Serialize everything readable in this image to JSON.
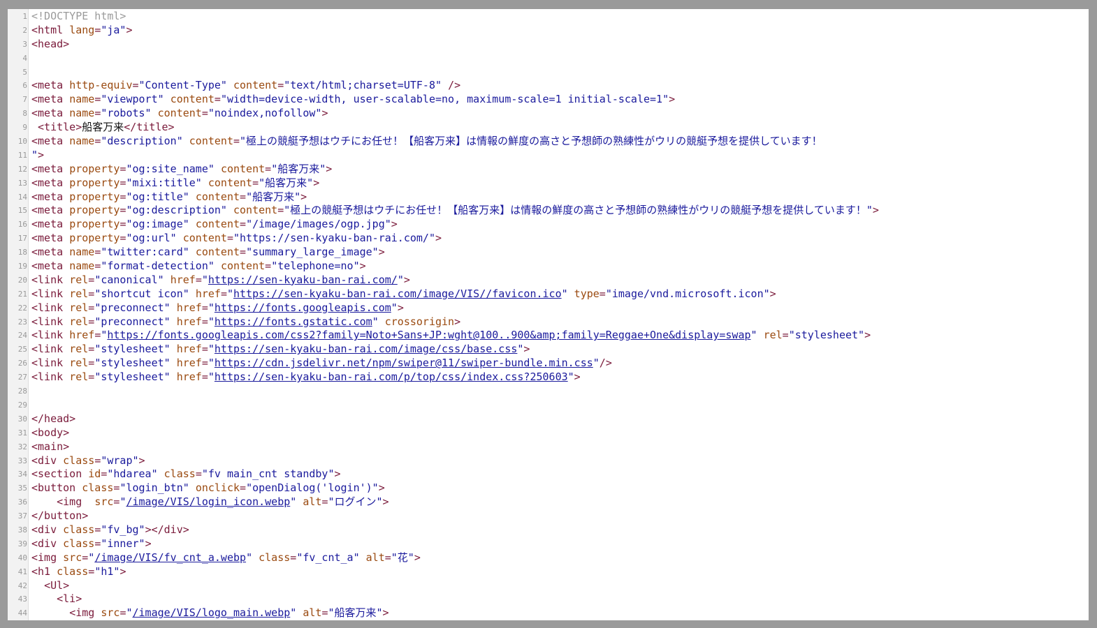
{
  "lines": [
    [
      [
        "doctype",
        "<!DOCTYPE html>"
      ]
    ],
    [
      [
        "tag",
        "<html "
      ],
      [
        "an",
        "lang"
      ],
      [
        "tag",
        "="
      ],
      [
        "av",
        "\"ja\""
      ],
      [
        "tag",
        ">"
      ]
    ],
    [
      [
        "tag",
        "<head>"
      ]
    ],
    [],
    [],
    [
      [
        "tag",
        "<meta "
      ],
      [
        "an",
        "http-equiv"
      ],
      [
        "tag",
        "="
      ],
      [
        "av",
        "\"Content-Type\""
      ],
      [
        "tx",
        " "
      ],
      [
        "an",
        "content"
      ],
      [
        "tag",
        "="
      ],
      [
        "av",
        "\"text/html;charset=UTF-8\""
      ],
      [
        "tx",
        " "
      ],
      [
        "tag",
        "/>"
      ]
    ],
    [
      [
        "tag",
        "<meta "
      ],
      [
        "an",
        "name"
      ],
      [
        "tag",
        "="
      ],
      [
        "av",
        "\"viewport\""
      ],
      [
        "tx",
        " "
      ],
      [
        "an",
        "content"
      ],
      [
        "tag",
        "="
      ],
      [
        "av",
        "\"width=device-width, user-scalable=no, maximum-scale=1 initial-scale=1\""
      ],
      [
        "tag",
        ">"
      ]
    ],
    [
      [
        "tag",
        "<meta "
      ],
      [
        "an",
        "name"
      ],
      [
        "tag",
        "="
      ],
      [
        "av",
        "\"robots\""
      ],
      [
        "tx",
        " "
      ],
      [
        "an",
        "content"
      ],
      [
        "tag",
        "="
      ],
      [
        "av",
        "\"noindex,nofollow\""
      ],
      [
        "tag",
        ">"
      ]
    ],
    [
      [
        "tx",
        " "
      ],
      [
        "tag",
        "<title>"
      ],
      [
        "tx",
        "船客万来"
      ],
      [
        "tag",
        "</title>"
      ]
    ],
    [
      [
        "tag",
        "<meta "
      ],
      [
        "an",
        "name"
      ],
      [
        "tag",
        "="
      ],
      [
        "av",
        "\"description\""
      ],
      [
        "tx",
        " "
      ],
      [
        "an",
        "content"
      ],
      [
        "tag",
        "="
      ],
      [
        "av",
        "\"極上の競艇予想はウチにお任せ！【船客万来】は情報の鮮度の高さと予想師の熟練性がウリの競艇予想を提供しています！"
      ]
    ],
    [
      [
        "av",
        "\""
      ],
      [
        "tag",
        ">"
      ]
    ],
    [
      [
        "tag",
        "<meta "
      ],
      [
        "an",
        "property"
      ],
      [
        "tag",
        "="
      ],
      [
        "av",
        "\"og:site_name\""
      ],
      [
        "tx",
        " "
      ],
      [
        "an",
        "content"
      ],
      [
        "tag",
        "="
      ],
      [
        "av",
        "\"船客万来\""
      ],
      [
        "tag",
        ">"
      ]
    ],
    [
      [
        "tag",
        "<meta "
      ],
      [
        "an",
        "property"
      ],
      [
        "tag",
        "="
      ],
      [
        "av",
        "\"mixi:title\""
      ],
      [
        "tx",
        " "
      ],
      [
        "an",
        "content"
      ],
      [
        "tag",
        "="
      ],
      [
        "av",
        "\"船客万来\""
      ],
      [
        "tag",
        ">"
      ]
    ],
    [
      [
        "tag",
        "<meta "
      ],
      [
        "an",
        "property"
      ],
      [
        "tag",
        "="
      ],
      [
        "av",
        "\"og:title\""
      ],
      [
        "tx",
        " "
      ],
      [
        "an",
        "content"
      ],
      [
        "tag",
        "="
      ],
      [
        "av",
        "\"船客万来\""
      ],
      [
        "tag",
        ">"
      ]
    ],
    [
      [
        "tag",
        "<meta "
      ],
      [
        "an",
        "property"
      ],
      [
        "tag",
        "="
      ],
      [
        "av",
        "\"og:description\""
      ],
      [
        "tx",
        " "
      ],
      [
        "an",
        "content"
      ],
      [
        "tag",
        "="
      ],
      [
        "av",
        "\"極上の競艇予想はウチにお任せ！【船客万来】は情報の鮮度の高さと予想師の熟練性がウリの競艇予想を提供しています！\""
      ],
      [
        "tag",
        ">"
      ]
    ],
    [
      [
        "tag",
        "<meta "
      ],
      [
        "an",
        "property"
      ],
      [
        "tag",
        "="
      ],
      [
        "av",
        "\"og:image\""
      ],
      [
        "tx",
        " "
      ],
      [
        "an",
        "content"
      ],
      [
        "tag",
        "="
      ],
      [
        "av",
        "\"/image/images/ogp.jpg\""
      ],
      [
        "tag",
        ">"
      ]
    ],
    [
      [
        "tag",
        "<meta "
      ],
      [
        "an",
        "property"
      ],
      [
        "tag",
        "="
      ],
      [
        "av",
        "\"og:url\""
      ],
      [
        "tx",
        " "
      ],
      [
        "an",
        "content"
      ],
      [
        "tag",
        "="
      ],
      [
        "av",
        "\"https://sen-kyaku-ban-rai.com/\""
      ],
      [
        "tag",
        ">"
      ]
    ],
    [
      [
        "tag",
        "<meta "
      ],
      [
        "an",
        "name"
      ],
      [
        "tag",
        "="
      ],
      [
        "av",
        "\"twitter:card\""
      ],
      [
        "tx",
        " "
      ],
      [
        "an",
        "content"
      ],
      [
        "tag",
        "="
      ],
      [
        "av",
        "\"summary_large_image\""
      ],
      [
        "tag",
        ">"
      ]
    ],
    [
      [
        "tag",
        "<meta "
      ],
      [
        "an",
        "name"
      ],
      [
        "tag",
        "="
      ],
      [
        "av",
        "\"format-detection\""
      ],
      [
        "tx",
        " "
      ],
      [
        "an",
        "content"
      ],
      [
        "tag",
        "="
      ],
      [
        "av",
        "\"telephone=no\""
      ],
      [
        "tag",
        ">"
      ]
    ],
    [
      [
        "tag",
        "<link "
      ],
      [
        "an",
        "rel"
      ],
      [
        "tag",
        "="
      ],
      [
        "av",
        "\"canonical\""
      ],
      [
        "tx",
        " "
      ],
      [
        "an",
        "href"
      ],
      [
        "tag",
        "="
      ],
      [
        "av",
        "\""
      ],
      [
        "lk",
        "https://sen-kyaku-ban-rai.com/"
      ],
      [
        "av",
        "\""
      ],
      [
        "tag",
        ">"
      ]
    ],
    [
      [
        "tag",
        "<link "
      ],
      [
        "an",
        "rel"
      ],
      [
        "tag",
        "="
      ],
      [
        "av",
        "\"shortcut icon\""
      ],
      [
        "tx",
        " "
      ],
      [
        "an",
        "href"
      ],
      [
        "tag",
        "="
      ],
      [
        "av",
        "\""
      ],
      [
        "lk",
        "https://sen-kyaku-ban-rai.com/image/VIS//favicon.ico"
      ],
      [
        "av",
        "\""
      ],
      [
        "tx",
        " "
      ],
      [
        "an",
        "type"
      ],
      [
        "tag",
        "="
      ],
      [
        "av",
        "\"image/vnd.microsoft.icon\""
      ],
      [
        "tag",
        ">"
      ]
    ],
    [
      [
        "tag",
        "<link "
      ],
      [
        "an",
        "rel"
      ],
      [
        "tag",
        "="
      ],
      [
        "av",
        "\"preconnect\""
      ],
      [
        "tx",
        " "
      ],
      [
        "an",
        "href"
      ],
      [
        "tag",
        "="
      ],
      [
        "av",
        "\""
      ],
      [
        "lk",
        "https://fonts.googleapis.com"
      ],
      [
        "av",
        "\""
      ],
      [
        "tag",
        ">"
      ]
    ],
    [
      [
        "tag",
        "<link "
      ],
      [
        "an",
        "rel"
      ],
      [
        "tag",
        "="
      ],
      [
        "av",
        "\"preconnect\""
      ],
      [
        "tx",
        " "
      ],
      [
        "an",
        "href"
      ],
      [
        "tag",
        "="
      ],
      [
        "av",
        "\""
      ],
      [
        "lk",
        "https://fonts.gstatic.com"
      ],
      [
        "av",
        "\""
      ],
      [
        "tx",
        " "
      ],
      [
        "an",
        "crossorigin"
      ],
      [
        "tag",
        ">"
      ]
    ],
    [
      [
        "tag",
        "<link "
      ],
      [
        "an",
        "href"
      ],
      [
        "tag",
        "="
      ],
      [
        "av",
        "\""
      ],
      [
        "lk",
        "https://fonts.googleapis.com/css2?family=Noto+Sans+JP:wght@100..900&amp;family=Reggae+One&display=swap"
      ],
      [
        "av",
        "\""
      ],
      [
        "tx",
        " "
      ],
      [
        "an",
        "rel"
      ],
      [
        "tag",
        "="
      ],
      [
        "av",
        "\"stylesheet\""
      ],
      [
        "tag",
        ">"
      ]
    ],
    [
      [
        "tag",
        "<link "
      ],
      [
        "an",
        "rel"
      ],
      [
        "tag",
        "="
      ],
      [
        "av",
        "\"stylesheet\""
      ],
      [
        "tx",
        " "
      ],
      [
        "an",
        "href"
      ],
      [
        "tag",
        "="
      ],
      [
        "av",
        "\""
      ],
      [
        "lk",
        "https://sen-kyaku-ban-rai.com/image/css/base.css"
      ],
      [
        "av",
        "\""
      ],
      [
        "tag",
        ">"
      ]
    ],
    [
      [
        "tag",
        "<link "
      ],
      [
        "an",
        "rel"
      ],
      [
        "tag",
        "="
      ],
      [
        "av",
        "\"stylesheet\""
      ],
      [
        "tx",
        " "
      ],
      [
        "an",
        "href"
      ],
      [
        "tag",
        "="
      ],
      [
        "av",
        "\""
      ],
      [
        "lk",
        "https://cdn.jsdelivr.net/npm/swiper@11/swiper-bundle.min.css"
      ],
      [
        "av",
        "\""
      ],
      [
        "tag",
        "/>"
      ]
    ],
    [
      [
        "tag",
        "<link "
      ],
      [
        "an",
        "rel"
      ],
      [
        "tag",
        "="
      ],
      [
        "av",
        "\"stylesheet\""
      ],
      [
        "tx",
        " "
      ],
      [
        "an",
        "href"
      ],
      [
        "tag",
        "="
      ],
      [
        "av",
        "\""
      ],
      [
        "lk",
        "https://sen-kyaku-ban-rai.com/p/top/css/index.css?250603"
      ],
      [
        "av",
        "\""
      ],
      [
        "tag",
        ">"
      ]
    ],
    [],
    [],
    [
      [
        "tag",
        "</head>"
      ]
    ],
    [
      [
        "tag",
        "<body>"
      ]
    ],
    [
      [
        "tag",
        "<main>"
      ]
    ],
    [
      [
        "tag",
        "<div "
      ],
      [
        "an",
        "class"
      ],
      [
        "tag",
        "="
      ],
      [
        "av",
        "\"wrap\""
      ],
      [
        "tag",
        ">"
      ]
    ],
    [
      [
        "tag",
        "<section "
      ],
      [
        "an",
        "id"
      ],
      [
        "tag",
        "="
      ],
      [
        "av",
        "\"hdarea\""
      ],
      [
        "tx",
        " "
      ],
      [
        "an",
        "class"
      ],
      [
        "tag",
        "="
      ],
      [
        "av",
        "\"fv main_cnt standby\""
      ],
      [
        "tag",
        ">"
      ]
    ],
    [
      [
        "tag",
        "<button "
      ],
      [
        "an",
        "class"
      ],
      [
        "tag",
        "="
      ],
      [
        "av",
        "\"login_btn\""
      ],
      [
        "tx",
        " "
      ],
      [
        "an",
        "onclick"
      ],
      [
        "tag",
        "="
      ],
      [
        "av",
        "\"openDialog('login')\""
      ],
      [
        "tag",
        ">"
      ]
    ],
    [
      [
        "tx",
        "    "
      ],
      [
        "tag",
        "<img "
      ],
      [
        "tx",
        " "
      ],
      [
        "an",
        "src"
      ],
      [
        "tag",
        "="
      ],
      [
        "av",
        "\""
      ],
      [
        "lk",
        "/image/VIS/login_icon.webp"
      ],
      [
        "av",
        "\""
      ],
      [
        "tx",
        " "
      ],
      [
        "an",
        "alt"
      ],
      [
        "tag",
        "="
      ],
      [
        "av",
        "\"ログイン\""
      ],
      [
        "tag",
        ">"
      ]
    ],
    [
      [
        "tag",
        "</button>"
      ]
    ],
    [
      [
        "tag",
        "<div "
      ],
      [
        "an",
        "class"
      ],
      [
        "tag",
        "="
      ],
      [
        "av",
        "\"fv_bg\""
      ],
      [
        "tag",
        "></div>"
      ]
    ],
    [
      [
        "tag",
        "<div "
      ],
      [
        "an",
        "class"
      ],
      [
        "tag",
        "="
      ],
      [
        "av",
        "\"inner\""
      ],
      [
        "tag",
        ">"
      ]
    ],
    [
      [
        "tag",
        "<img "
      ],
      [
        "an",
        "src"
      ],
      [
        "tag",
        "="
      ],
      [
        "av",
        "\""
      ],
      [
        "lk",
        "/image/VIS/fv_cnt_a.webp"
      ],
      [
        "av",
        "\""
      ],
      [
        "tx",
        " "
      ],
      [
        "an",
        "class"
      ],
      [
        "tag",
        "="
      ],
      [
        "av",
        "\"fv_cnt_a\""
      ],
      [
        "tx",
        " "
      ],
      [
        "an",
        "alt"
      ],
      [
        "tag",
        "="
      ],
      [
        "av",
        "\"花\""
      ],
      [
        "tag",
        ">"
      ]
    ],
    [
      [
        "tag",
        "<h1 "
      ],
      [
        "an",
        "class"
      ],
      [
        "tag",
        "="
      ],
      [
        "av",
        "\"h1\""
      ],
      [
        "tag",
        ">"
      ]
    ],
    [
      [
        "tx",
        "  "
      ],
      [
        "tag",
        "<Ul>"
      ]
    ],
    [
      [
        "tx",
        "    "
      ],
      [
        "tag",
        "<li>"
      ]
    ],
    [
      [
        "tx",
        "      "
      ],
      [
        "tag",
        "<img "
      ],
      [
        "an",
        "src"
      ],
      [
        "tag",
        "="
      ],
      [
        "av",
        "\""
      ],
      [
        "lk",
        "/image/VIS/logo_main.webp"
      ],
      [
        "av",
        "\""
      ],
      [
        "tx",
        " "
      ],
      [
        "an",
        "alt"
      ],
      [
        "tag",
        "="
      ],
      [
        "av",
        "\"船客万来\""
      ],
      [
        "tag",
        ">"
      ]
    ]
  ]
}
